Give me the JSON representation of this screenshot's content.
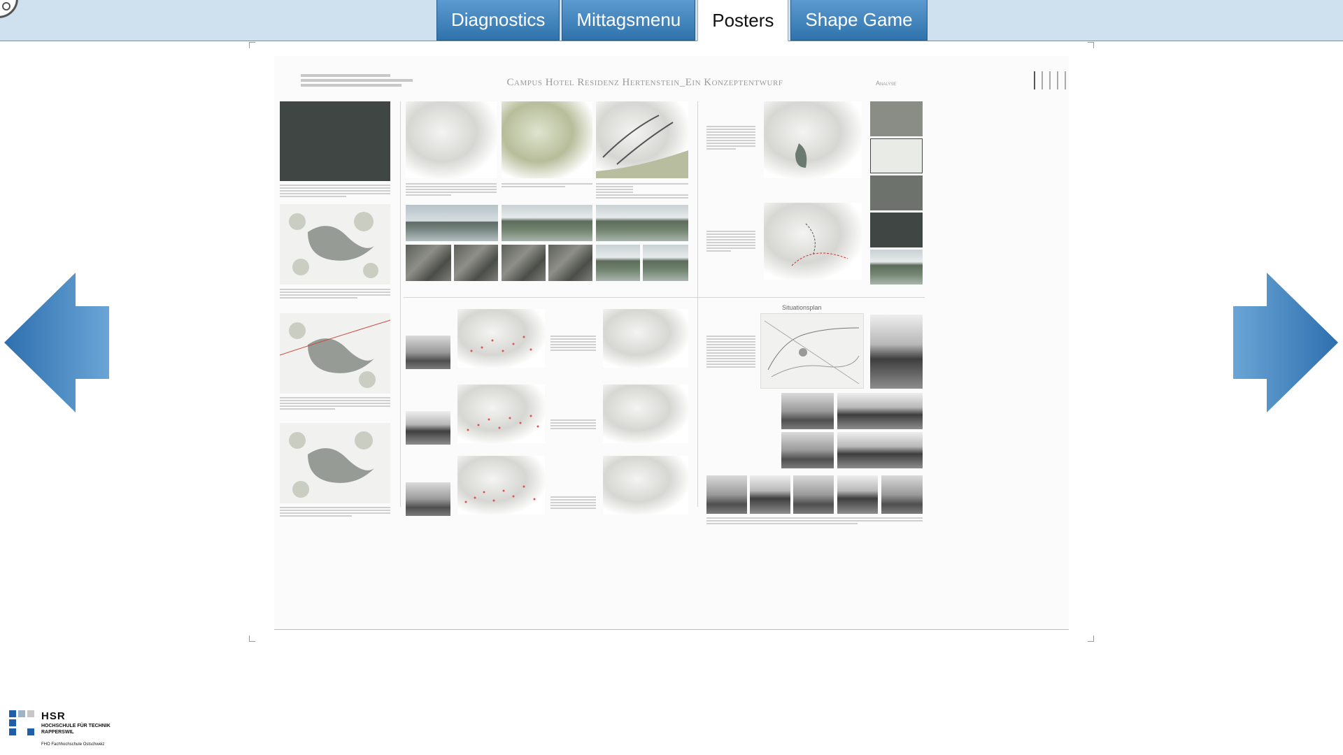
{
  "tabs": [
    {
      "label": "Diagnostics",
      "active": false
    },
    {
      "label": "Mittagsmenu",
      "active": false
    },
    {
      "label": "Posters",
      "active": true
    },
    {
      "label": "Shape Game",
      "active": false
    }
  ],
  "poster": {
    "title": "Campus Hotel Residenz Hertenstein_Ein Konzeptentwurf",
    "section": "Analyse",
    "situationsplan_label": "Situationsplan"
  },
  "nav": {
    "prev_icon": "arrow-left-icon",
    "next_icon": "arrow-right-icon"
  },
  "logo": {
    "name": "HSR",
    "line1": "HOCHSCHULE FÜR TECHNIK",
    "line2": "RAPPERSWIL",
    "line3": "FHO Fachhochschule Ostschweiz"
  },
  "colors": {
    "topbar": "#cfe1ee",
    "tab": "#3f83bf",
    "arrow": "#3f8ac4",
    "logo_blue": "#1f5ea8"
  }
}
